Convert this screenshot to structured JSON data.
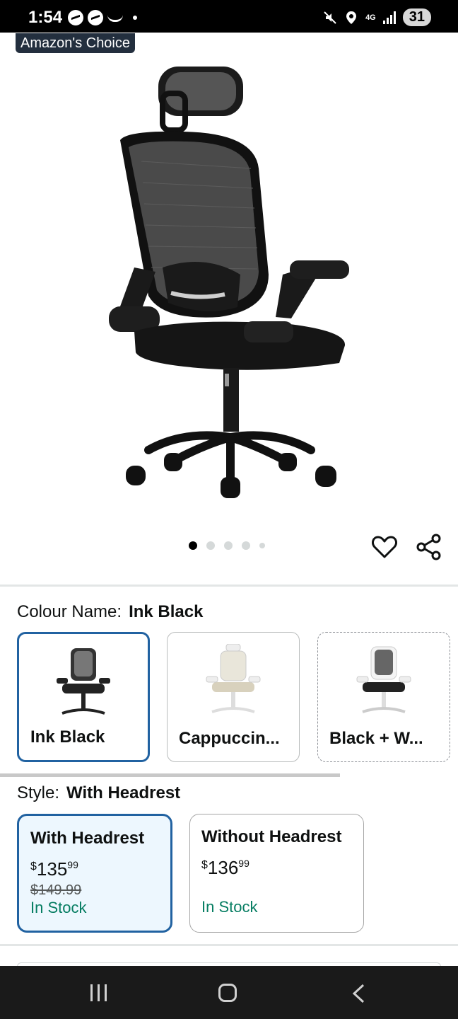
{
  "status_bar": {
    "time": "1:54",
    "network": "4G",
    "battery": "31"
  },
  "badge": {
    "label": "Amazon's Choice"
  },
  "carousel": {
    "image_count": 5,
    "active_index": 0
  },
  "colour": {
    "label": "Colour Name:",
    "selected_value": "Ink Black",
    "options": [
      {
        "name": "Ink Black",
        "selected": true
      },
      {
        "name": "Cappuccin...",
        "selected": false
      },
      {
        "name": "Black + W...",
        "selected": false
      }
    ]
  },
  "style": {
    "label": "Style:",
    "selected_value": "With Headrest",
    "options": [
      {
        "title": "With Headrest",
        "currency": "$",
        "price_whole": "135",
        "price_fraction": "99",
        "was_price": "$149.99",
        "stock": "In Stock",
        "selected": true
      },
      {
        "title": "Without Headrest",
        "currency": "$",
        "price_whole": "136",
        "price_fraction": "99",
        "was_price": "",
        "stock": "In Stock",
        "selected": false
      }
    ]
  },
  "colors": {
    "accent_blue": "#2162a1",
    "stock_green": "#067d62",
    "badge_bg": "#232f3e"
  },
  "icons": [
    "messenger-icon",
    "messenger-icon",
    "amazon-smile-icon",
    "mute-icon",
    "location-icon",
    "signal-icon",
    "heart-icon",
    "share-icon",
    "recent-apps-icon",
    "home-icon",
    "back-icon"
  ]
}
